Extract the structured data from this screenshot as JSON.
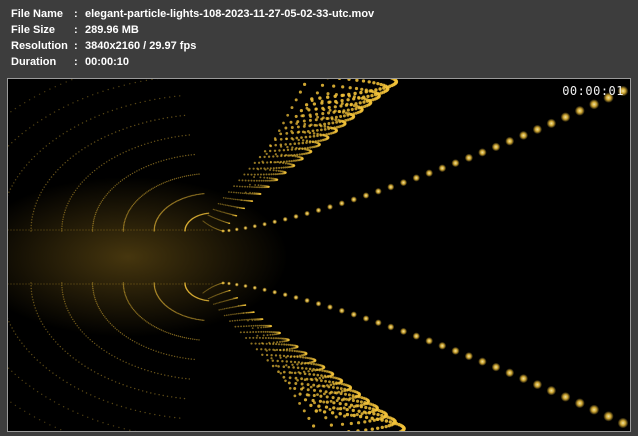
{
  "file_info": {
    "rows": [
      {
        "label": "File Name",
        "separator": ":",
        "value": "elegant-particle-lights-108-2023-11-27-05-02-33-utc.mov"
      },
      {
        "label": "File Size",
        "separator": ":",
        "value": "289.96 MB"
      },
      {
        "label": "Resolution",
        "separator": ":",
        "value": "3840x2160 / 29.97 fps"
      },
      {
        "label": "Duration",
        "separator": ":",
        "value": "00:00:10"
      }
    ]
  },
  "player": {
    "timecode": "00:00:01"
  },
  "colors": {
    "background": "#3d3d3d",
    "text": "#ffffff",
    "particle": "#f2c23a",
    "video_background": "#000000"
  }
}
